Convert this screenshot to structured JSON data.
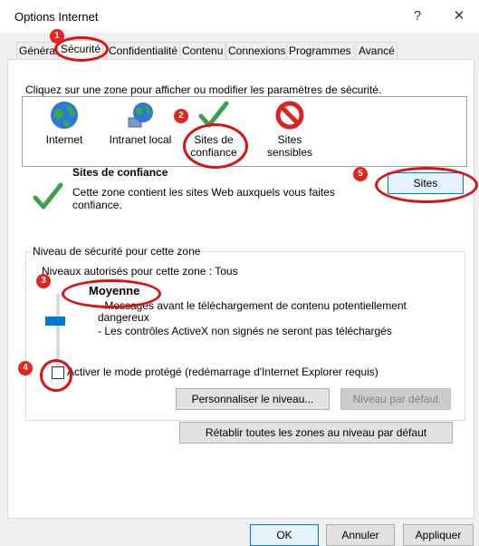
{
  "window": {
    "title": "Options Internet",
    "help_glyph": "?",
    "close_glyph": "✕"
  },
  "tabs": [
    "Général",
    "Sécurité",
    "Confidentialité",
    "Contenu",
    "Connexions",
    "Programmes",
    "Avancé"
  ],
  "active_tab": "Sécurité",
  "security": {
    "instruction": "Cliquez sur une zone pour afficher ou modifier les paramètres de sécurité.",
    "zones": [
      {
        "label": "Internet",
        "icon": "globe-icon"
      },
      {
        "label": "Intranet local",
        "icon": "network-globe-icon"
      },
      {
        "label": "Sites de confiance",
        "icon": "checkmark-icon",
        "line1": "Sites de",
        "line2": "confiance"
      },
      {
        "label": "Sites sensibles",
        "icon": "restricted-icon"
      }
    ],
    "selected_zone": {
      "title": "Sites de confiance",
      "description_line1": "Cette zone contient les sites Web auxquels vous faites",
      "description_line2": "confiance."
    },
    "sites_button": "Sites",
    "level_group": {
      "legend": "Niveau de sécurité pour cette zone",
      "allowed_levels": "Niveaux autorisés pour cette zone : Tous",
      "level_name": "Moyenne",
      "bullet1_line1": "- Messages avant le téléchargement de contenu potentiellement",
      "bullet1_line2": "dangereux",
      "bullet2": "- Les contrôles ActiveX non signés ne seront pas téléchargés",
      "slider_level": 0.55
    },
    "protected_mode_label": "Activer le mode protégé (redémarrage d'Internet Explorer requis)",
    "protected_mode_checked": false,
    "customize_button": "Personnaliser le niveau...",
    "default_level_button": "Niveau par défaut",
    "reset_all_button": "Rétablir toutes les zones au niveau par défaut"
  },
  "footer": {
    "ok": "OK",
    "cancel": "Annuler",
    "apply": "Appliquer"
  },
  "annotations": [
    "1",
    "2",
    "3",
    "4",
    "5"
  ],
  "colors": {
    "accent": "#0078d7",
    "annotation": "#e5251c",
    "trusted_green": "#3aa34a",
    "restricted_red": "#d9251d"
  }
}
